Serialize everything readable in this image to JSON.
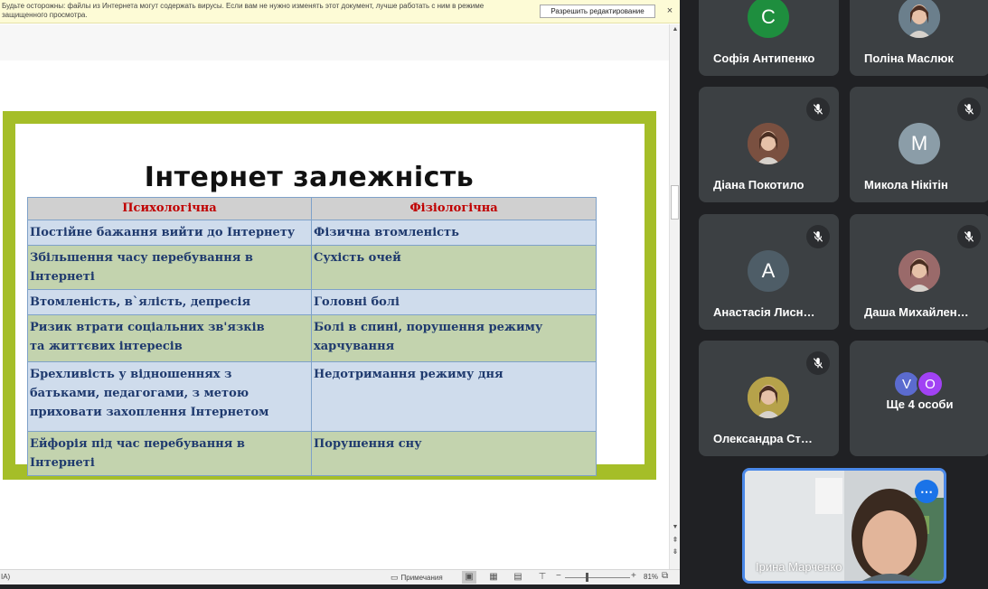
{
  "protected_view": {
    "message": "Будьте осторожны: файлы из Интернета могут содержать вирусы. Если вам не нужно изменять этот документ, лучше работать с ним в режиме защищенного просмотра.",
    "enable_editing_label": "Разрешить редактирование",
    "close_label": "×"
  },
  "slide": {
    "title": "Інтернет залежність",
    "table": {
      "headers": [
        "Психологічна",
        "Фізіологічна"
      ],
      "rows": [
        {
          "style": "blue",
          "psych": "Постійне бажання вийти до Інтернету",
          "phys": "Фізична втомленість"
        },
        {
          "style": "green",
          "psych": "Збільшення часу перебування в Інтернеті",
          "phys": "Сухість очей"
        },
        {
          "style": "blue",
          "psych": "Втомленість,  в`ялість,  депресія",
          "phys": "Головні болі"
        },
        {
          "style": "green",
          "psych": "Ризик втрати соціальних зв'язків\nта життєвих інтересів",
          "phys": "Болі в спині, порушення режиму\nхарчування"
        },
        {
          "style": "blue",
          "psych": "Брехливість у відношеннях з\nбатьками, педагогами, з метою\nприховати захоплення Інтернетом",
          "phys": "Недотримання режиму дня"
        },
        {
          "style": "green",
          "psych": "Ейфорія під час перебування в Інтернеті",
          "phys": "Порушення сну"
        }
      ]
    }
  },
  "statusbar": {
    "language": "IA)",
    "notes_label": "Примечания",
    "zoom_level": "81%",
    "zoom_value_percent": 81
  },
  "meet": {
    "tiles": [
      {
        "name": "Софія Антипенко",
        "initial": "С",
        "avatar_color": "#1e8e3e",
        "photo": false,
        "muted": false
      },
      {
        "name": "Поліна Маслюк",
        "initial": "",
        "avatar_color": "#6b7f8c",
        "photo": true,
        "muted": false
      },
      {
        "name": "Діана Покотило",
        "initial": "",
        "avatar_color": "#7a5040",
        "photo": true,
        "muted": true
      },
      {
        "name": "Микола Нікітін",
        "initial": "М",
        "avatar_color": "#8b9da8",
        "photo": false,
        "muted": true
      },
      {
        "name": "Анастасія Лисн…",
        "initial": "А",
        "avatar_color": "#4e5d67",
        "photo": false,
        "muted": true
      },
      {
        "name": "Даша Михайлен…",
        "initial": "",
        "avatar_color": "#9a6a6a",
        "photo": true,
        "muted": true
      },
      {
        "name": "Олександра Ст…",
        "initial": "",
        "avatar_color": "#b6a24a",
        "photo": true,
        "muted": true
      }
    ],
    "more_tile": {
      "label": "Ще 4 особи",
      "avatars": [
        {
          "initial": "V",
          "color": "#5b6bcf"
        },
        {
          "initial": "O",
          "color": "#a142f4"
        }
      ]
    },
    "self_tile": {
      "name": "Ірина Марченко",
      "more_icon": "more-horiz-icon"
    },
    "icons": {
      "mic_off": "mic-off-icon"
    }
  }
}
